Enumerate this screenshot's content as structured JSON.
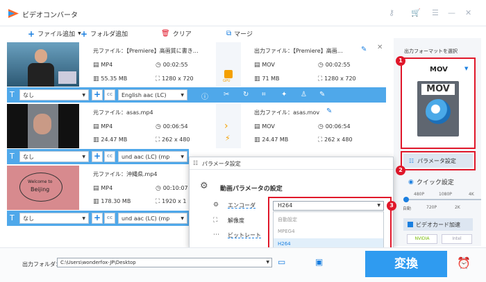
{
  "app": {
    "title": "ビデオコンバータ"
  },
  "toolbar": {
    "add_file": "ファイル追加",
    "add_folder": "フォルダ追加",
    "clear": "クリア",
    "merge": "マージ"
  },
  "rows": [
    {
      "src_name": "元ファイル：【Premiere】高画質に書き…",
      "src_format": "MP4",
      "src_duration": "00:02:55",
      "src_size": "55.35 MB",
      "src_res": "1280 x 720",
      "out_name": "出力ファイル：【Premiere】高画…",
      "out_format": "MOV",
      "out_duration": "00:02:55",
      "out_size": "71 MB",
      "out_res": "1280 x 720",
      "mid_label": "GPU",
      "subtitle": "なし",
      "audio": "English aac (LC)"
    },
    {
      "src_name": "元ファイル：asas.mp4",
      "src_format": "MP4",
      "src_duration": "00:06:54",
      "src_size": "24.47 MB",
      "src_res": "262 x 480",
      "out_name": "出力ファイル：asas.mov",
      "out_format": "MOV",
      "out_duration": "00:06:54",
      "out_size": "24.47 MB",
      "out_res": "262 x 480",
      "subtitle": "なし",
      "audio": "und aac (LC) (mp"
    },
    {
      "src_name": "元ファイル：沖縄県.mp4",
      "src_format": "MP4",
      "src_duration": "00:10:07",
      "src_size": "178.30 MB",
      "src_res": "1920 x 1",
      "subtitle": "なし",
      "audio": "und aac (LC) (mp"
    }
  ],
  "thumb3_text": [
    "Welcome to",
    "Beijing"
  ],
  "right": {
    "format_label": "出力フォーマットを選択",
    "format_value": "MOV",
    "format_icon_text": "MOV",
    "param_button": "パラメータ設定",
    "quick_label": "クイック設定",
    "quick_ticks_top": [
      "480P",
      "1080P",
      "4K"
    ],
    "quick_ticks_bottom": [
      "自動",
      "720P",
      "2K"
    ],
    "accel_label": "ビデオカード加速",
    "gpu_nvidia": "NVIDIA",
    "gpu_intel": "Intel"
  },
  "badges": [
    "1",
    "2",
    "3"
  ],
  "popup": {
    "title": "パラメータ設定",
    "heading": "動画パラメータの設定",
    "labels": [
      "エンコーダ",
      "解像度",
      "ビットレート"
    ],
    "encoder_value": "H264",
    "options": [
      "自動設定",
      "MPEG4",
      "H264"
    ]
  },
  "bottom": {
    "folder_label": "出力フォルダ：",
    "folder_path": "C:\\Users\\wonderfox-JP\\Desktop",
    "convert": "変換"
  }
}
